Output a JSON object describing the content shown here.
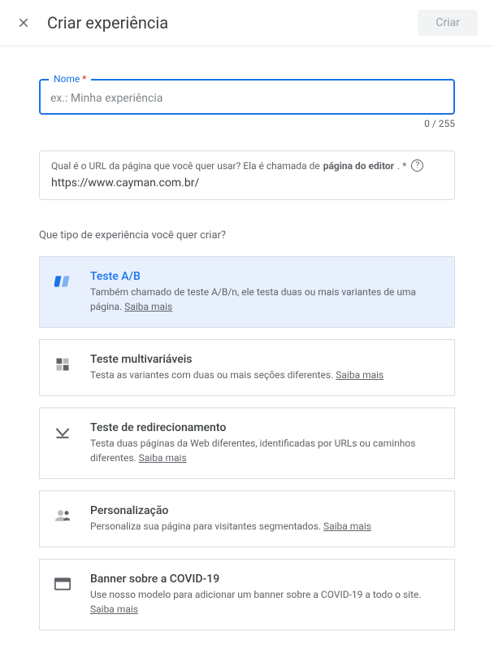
{
  "header": {
    "title": "Criar experiência",
    "create_label": "Criar"
  },
  "name_field": {
    "label": "Nome",
    "placeholder": "ex.: Minha experiência",
    "counter": "0 / 255"
  },
  "url_field": {
    "question_prefix": "Qual é o URL da página que você quer usar? Ela é chamada de ",
    "question_strong": "página do editor",
    "question_suffix": ". *",
    "value": "https://www.cayman.com.br/"
  },
  "type_question": "Que tipo de experiência você quer criar?",
  "options": {
    "ab": {
      "title": "Teste A/B",
      "desc_before": "Também chamado de teste A/B/n, ele testa duas ou mais variantes de uma página. ",
      "learn": "Saiba mais"
    },
    "mv": {
      "title": "Teste multivariáveis",
      "desc_before": "Testa as variantes com duas ou mais seções diferentes. ",
      "learn": "Saiba mais"
    },
    "redirect": {
      "title": "Teste de redirecionamento",
      "desc_before": "Testa duas páginas da Web diferentes, identificadas por URLs ou caminhos diferentes. ",
      "learn": "Saiba mais"
    },
    "perso": {
      "title": "Personalização",
      "desc_before": "Personaliza sua página para visitantes segmentados. ",
      "learn": "Saiba mais"
    },
    "covid": {
      "title": "Banner sobre a COVID-19",
      "desc_before": "Use nosso modelo para adicionar um banner sobre a COVID-19 a todo o site. ",
      "learn": "Saiba mais"
    }
  }
}
